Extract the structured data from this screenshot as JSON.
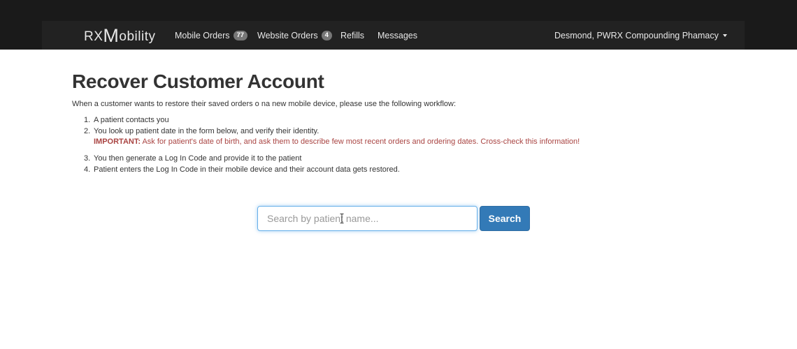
{
  "navbar": {
    "brand_prefix": "RX",
    "brand_m": "M",
    "brand_suffix": "obility",
    "items": [
      {
        "label": "Mobile Orders",
        "badge": "77"
      },
      {
        "label": "Website Orders",
        "badge": "4"
      },
      {
        "label": "Refills"
      },
      {
        "label": "Messages"
      }
    ],
    "user_menu": "Desmond, PWRX Compounding Phamacy",
    "user_menu_icon": "caret-down-icon",
    "colors": {
      "background": "#222222",
      "badge": "#777777"
    }
  },
  "page": {
    "title": "Recover Customer Account",
    "intro": "When a customer wants to restore their saved orders o na new mobile device, please use the following workflow:",
    "steps": [
      {
        "num": "1.",
        "text": "A patient contacts you"
      },
      {
        "num": "2.",
        "text": "You look up patient date in the form below, and verify their identity."
      },
      {
        "num": "3.",
        "text": "You then generate a Log In Code and provide it to the patient"
      },
      {
        "num": "4.",
        "text": "Patient enters the Log In Code in their mobile device and their account data gets restored."
      }
    ],
    "important_label": "IMPORTANT:",
    "important_text": " Ask for patient's date of birth, and ask them to describe few most recent orders and ordering dates. Cross-check this information!",
    "important_color": "#a94442"
  },
  "search": {
    "placeholder": "Search by patient name...",
    "value": "",
    "button_label": "Search",
    "button_color": "#337ab7"
  }
}
